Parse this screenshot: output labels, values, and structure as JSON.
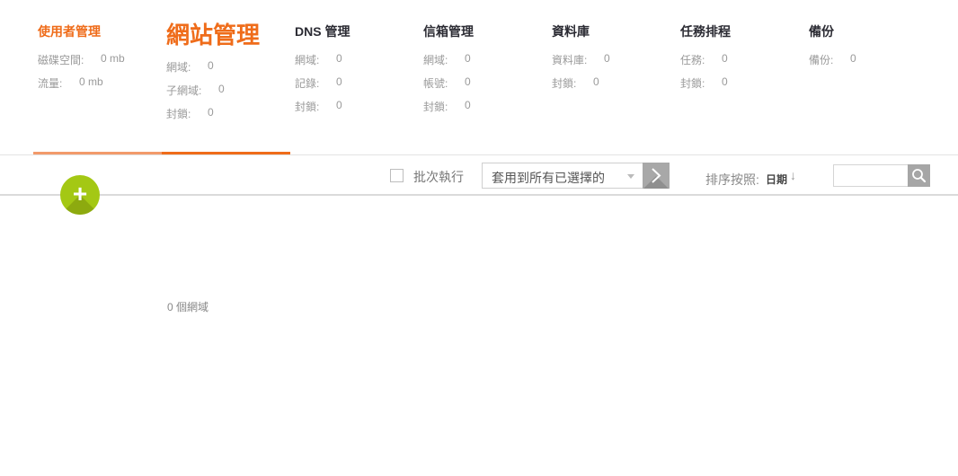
{
  "tabs": [
    {
      "id": "user",
      "title": "使用者管理",
      "stats": [
        {
          "label": "磁碟空間:",
          "value": "0 mb"
        },
        {
          "label": "流量:",
          "value": "0 mb"
        }
      ]
    },
    {
      "id": "site",
      "title": "網站管理",
      "stats": [
        {
          "label": "網域:",
          "value": "0"
        },
        {
          "label": "子網域:",
          "value": "0"
        },
        {
          "label": "封鎖:",
          "value": "0"
        }
      ]
    },
    {
      "id": "dns",
      "title": "DNS 管理",
      "stats": [
        {
          "label": "網域:",
          "value": "0"
        },
        {
          "label": "記錄:",
          "value": "0"
        },
        {
          "label": "封鎖:",
          "value": "0"
        }
      ]
    },
    {
      "id": "mail",
      "title": "信箱管理",
      "stats": [
        {
          "label": "網域:",
          "value": "0"
        },
        {
          "label": "帳號:",
          "value": "0"
        },
        {
          "label": "封鎖:",
          "value": "0"
        }
      ]
    },
    {
      "id": "db",
      "title": "資料庫",
      "stats": [
        {
          "label": "資料庫:",
          "value": "0"
        },
        {
          "label": "封鎖:",
          "value": "0"
        }
      ]
    },
    {
      "id": "cron",
      "title": "任務排程",
      "stats": [
        {
          "label": "任務:",
          "value": "0"
        },
        {
          "label": "封鎖:",
          "value": "0"
        }
      ]
    },
    {
      "id": "backup",
      "title": "備份",
      "stats": [
        {
          "label": "備份:",
          "value": "0"
        }
      ]
    }
  ],
  "colors": {
    "accent": "#ef6c1a",
    "accent_light": "#f29a6b",
    "add_button": "#a4c814",
    "divider": "#dadada"
  },
  "toolbar": {
    "add_icon": "plus-icon",
    "add_symbol": "+",
    "batch_label": "批次執行",
    "apply_select_value": "套用到所有已選擇的",
    "go_icon": "chevron-right-icon",
    "sort_label": "排序按照:",
    "sort_value": "日期",
    "sort_arrow": "↓",
    "search_value": "",
    "search_icon": "search-icon"
  },
  "list": {
    "count_text": "0 個網域"
  }
}
